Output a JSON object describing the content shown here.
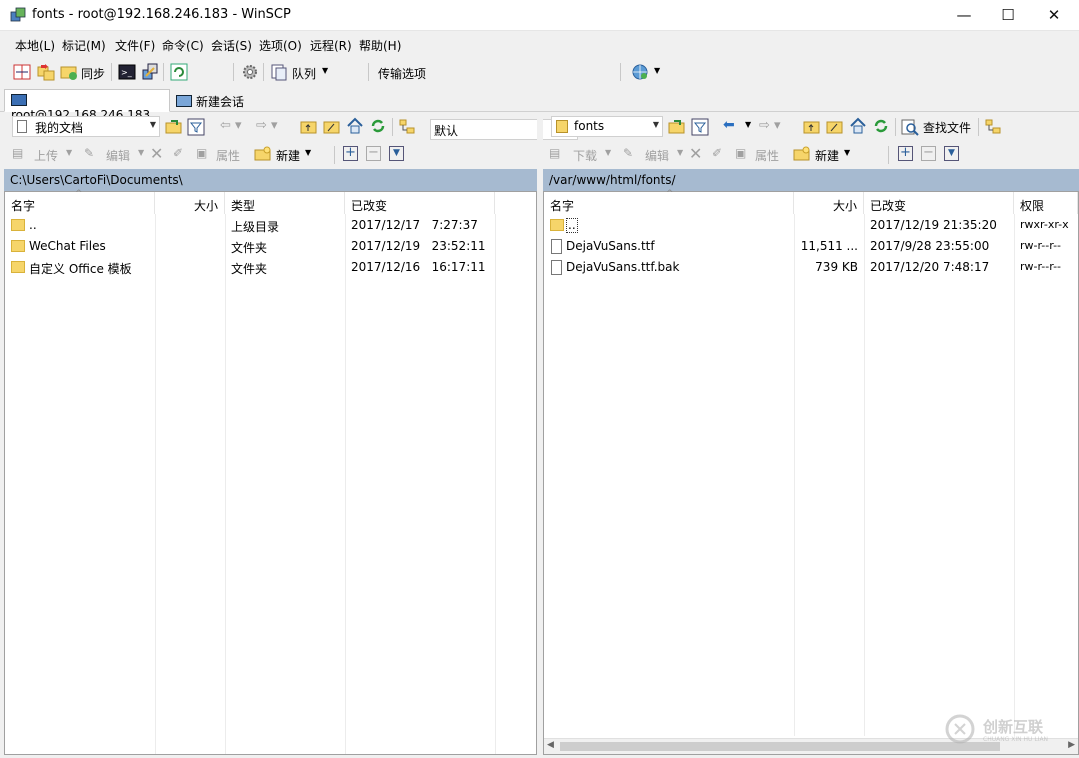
{
  "window": {
    "title": "fonts - root@192.168.246.183 - WinSCP",
    "controls": [
      "—",
      "☐",
      "✕"
    ]
  },
  "menu": [
    "本地(L)",
    "标记(M)",
    "文件(F)",
    "命令(C)",
    "会话(S)",
    "选项(O)",
    "远程(R)",
    "帮助(H)"
  ],
  "toolbar": {
    "sync_label": "同步",
    "queue_label": "队列",
    "transfer_label": "传输选项",
    "transfer_value": "默认"
  },
  "tabs": [
    {
      "label": "root@192.168.246.183",
      "active": true
    },
    {
      "label": "新建会话",
      "active": false
    }
  ],
  "left": {
    "location": "我的文档",
    "actions": {
      "upload": "上传",
      "edit": "编辑",
      "properties": "属性",
      "new": "新建"
    },
    "path": "C:\\Users\\CartoFi\\Documents\\",
    "columns": [
      "名字",
      "大小",
      "类型",
      "已改变"
    ],
    "rows": [
      {
        "name": "..",
        "size": "",
        "type": "上级目录",
        "changed": "2017/12/17   7:27:37",
        "kind": "up"
      },
      {
        "name": "WeChat Files",
        "size": "",
        "type": "文件夹",
        "changed": "2017/12/19   23:52:11",
        "kind": "folder"
      },
      {
        "name": "自定义 Office 模板",
        "size": "",
        "type": "文件夹",
        "changed": "2017/12/16   16:17:11",
        "kind": "folder"
      }
    ]
  },
  "right": {
    "location": "fonts",
    "actions": {
      "download": "下载",
      "edit": "编辑",
      "properties": "属性",
      "new": "新建",
      "find": "查找文件"
    },
    "path": "/var/www/html/fonts/",
    "columns": [
      "名字",
      "大小",
      "已改变",
      "权限"
    ],
    "rows": [
      {
        "name": "..",
        "size": "",
        "changed": "2017/12/19 21:35:20",
        "perm": "rwxr-xr-x",
        "kind": "up"
      },
      {
        "name": "DejaVuSans.ttf",
        "size": "11,511 ...",
        "changed": "2017/9/28 23:55:00",
        "perm": "rw-r--r--",
        "kind": "file"
      },
      {
        "name": "DejaVuSans.ttf.bak",
        "size": "739 KB",
        "changed": "2017/12/20 7:48:17",
        "perm": "rw-r--r--",
        "kind": "file"
      }
    ]
  },
  "watermark": {
    "text": "创新互联",
    "subtext": "CHUANG XIN HU LIAN"
  },
  "colors": {
    "path_bar": "#a6bad0",
    "folder": "#f6d56a"
  }
}
